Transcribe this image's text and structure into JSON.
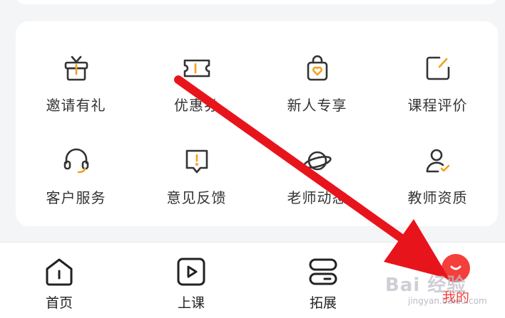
{
  "menu": {
    "items": [
      {
        "label": "邀请有礼",
        "icon": "gift-icon"
      },
      {
        "label": "优惠券",
        "icon": "coupon-icon"
      },
      {
        "label": "新人专享",
        "icon": "shopping-bag-heart-icon"
      },
      {
        "label": "课程评价",
        "icon": "edit-square-icon"
      },
      {
        "label": "客户服务",
        "icon": "headset-icon"
      },
      {
        "label": "意见反馈",
        "icon": "feedback-icon"
      },
      {
        "label": "老师动态",
        "icon": "planet-icon"
      },
      {
        "label": "教师资质",
        "icon": "user-check-icon"
      }
    ]
  },
  "tabbar": {
    "tabs": [
      {
        "label": "首页",
        "icon": "home-icon"
      },
      {
        "label": "上课",
        "icon": "play-icon"
      },
      {
        "label": "拓展",
        "icon": "expand-icon"
      },
      {
        "label": "我的",
        "icon": "profile-smile-icon",
        "active": true
      }
    ]
  },
  "watermark": {
    "text": "Bai 经验",
    "sub": "jingyan.baidu.com"
  },
  "colors": {
    "accent": "#f5a01c",
    "active": "#f43f3b",
    "arrow": "#e8141b",
    "text": "#333333"
  }
}
